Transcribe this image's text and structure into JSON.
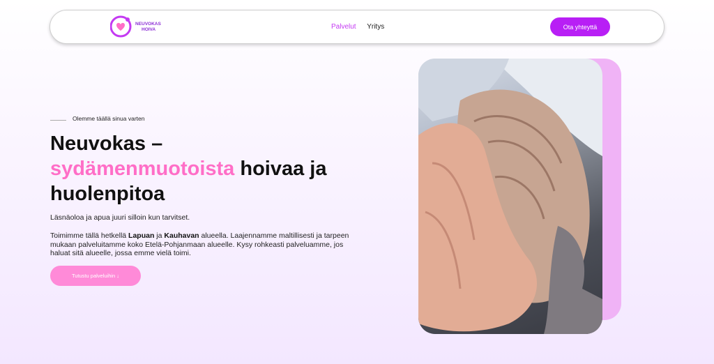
{
  "brand": {
    "name_line1": "NEUVOKAS",
    "name_line2": "HOIVA"
  },
  "nav": {
    "items": [
      {
        "label": "Palvelut"
      },
      {
        "label": "Yritys"
      }
    ],
    "cta_label": "Ota yhteyttä"
  },
  "hero": {
    "eyebrow": "Olemme täällä sinua varten",
    "title_part1": "Neuvokas –",
    "title_highlight": "sydämenmuotoista",
    "title_part2": "hoivaa ja",
    "title_part3": "huolenpitoa",
    "lead": "Läsnäoloa ja apua juuri silloin kun tarvitset.",
    "body_prefix": "Toimimme tällä hetkellä ",
    "body_loc1": "Lapuan",
    "body_mid": " ja ",
    "body_loc2": "Kauhavan",
    "body_suffix": " alueella. Laajennamme maltillisesti ja tarpeen mukaan palveluitamme koko Etelä-Pohjanmaan alueelle. Kysy rohkeasti palveluamme, jos haluat sitä alueelle, jossa emme vielä toimi.",
    "button_label": "Tutustu palveluihin ↓"
  },
  "colors": {
    "accent": "#b81ff5",
    "highlight": "#ff6ec7",
    "button_pink": "#ff8ad8",
    "panel": "#f0b3f6"
  },
  "icons": {
    "logo": "heart-logo-icon",
    "arrow": "arrow-down-icon"
  }
}
